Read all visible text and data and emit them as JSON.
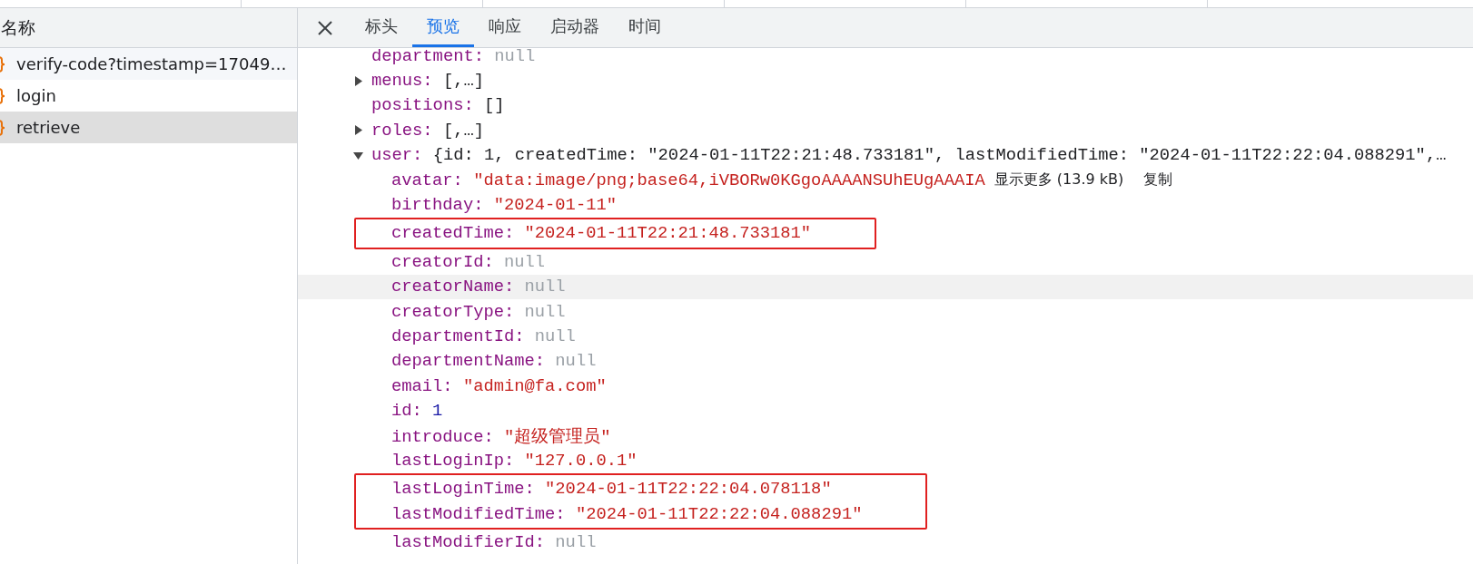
{
  "request_list": {
    "header": "名称",
    "items": [
      {
        "name": "verify-code?timestamp=17049…",
        "selected": false
      },
      {
        "name": "login",
        "selected": false
      },
      {
        "name": "retrieve",
        "selected": true
      }
    ]
  },
  "detail": {
    "tabs": [
      {
        "label": "标头",
        "selected": false
      },
      {
        "label": "预览",
        "selected": true
      },
      {
        "label": "响应",
        "selected": false
      },
      {
        "label": "启动器",
        "selected": false
      },
      {
        "label": "时间",
        "selected": false
      }
    ],
    "preview": {
      "rows": [
        {
          "key": "department:",
          "value": "null",
          "kind": "null",
          "hovered": false,
          "boxed": false
        },
        {
          "key": "menus:",
          "value": "[,…]",
          "kind": "preview",
          "expanded": false,
          "hovered": false,
          "boxed": false
        },
        {
          "key": "positions:",
          "value": "[]",
          "kind": "preview",
          "hovered": false,
          "boxed": false
        },
        {
          "key": "roles:",
          "value": "[,…]",
          "kind": "preview",
          "expanded": false,
          "hovered": false,
          "boxed": false
        },
        {
          "key": "user:",
          "value": "{id: 1, createdTime: \"2024-01-11T22:21:48.733181\", lastModifiedTime: \"2024-01-11T22:22:04.088291\",…",
          "kind": "preview",
          "expanded": true,
          "hovered": false,
          "boxed": false,
          "children": [
            {
              "key": "avatar:",
              "value": "\"data:image/png;base64,iVBORw0KGgoAAAANSUhEUgAAAIA",
              "kind": "string",
              "more": "显示更多 (13.9 kB)",
              "copy": "复制",
              "hovered": false,
              "boxed": false
            },
            {
              "key": "birthday:",
              "value": "\"2024-01-11\"",
              "kind": "string",
              "hovered": false,
              "boxed": false
            },
            {
              "key": "createdTime:",
              "value": "\"2024-01-11T22:21:48.733181\"",
              "kind": "string",
              "hovered": false,
              "boxed": true
            },
            {
              "key": "creatorId:",
              "value": "null",
              "kind": "null",
              "hovered": false,
              "boxed": false
            },
            {
              "key": "creatorName:",
              "value": "null",
              "kind": "null",
              "hovered": true,
              "boxed": false
            },
            {
              "key": "creatorType:",
              "value": "null",
              "kind": "null",
              "hovered": false,
              "boxed": false
            },
            {
              "key": "departmentId:",
              "value": "null",
              "kind": "null",
              "hovered": false,
              "boxed": false
            },
            {
              "key": "departmentName:",
              "value": "null",
              "kind": "null",
              "hovered": false,
              "boxed": false
            },
            {
              "key": "email:",
              "value": "\"admin@fa.com\"",
              "kind": "string",
              "hovered": false,
              "boxed": false
            },
            {
              "key": "id:",
              "value": "1",
              "kind": "number",
              "hovered": false,
              "boxed": false
            },
            {
              "key": "introduce:",
              "value": "\"超级管理员\"",
              "kind": "string",
              "hovered": false,
              "boxed": false
            },
            {
              "key": "lastLoginIp:",
              "value": "\"127.0.0.1\"",
              "kind": "string",
              "hovered": false,
              "boxed": false
            },
            {
              "key": "lastLoginTime:",
              "value": "\"2024-01-11T22:22:04.078118\"",
              "kind": "string",
              "hovered": false,
              "boxed": true
            },
            {
              "key": "lastModifiedTime:",
              "value": "\"2024-01-11T22:22:04.088291\"",
              "kind": "string",
              "hovered": false,
              "boxed": true
            },
            {
              "key": "lastModifierId:",
              "value": "null",
              "kind": "null",
              "hovered": false,
              "boxed": false
            }
          ]
        }
      ]
    }
  }
}
